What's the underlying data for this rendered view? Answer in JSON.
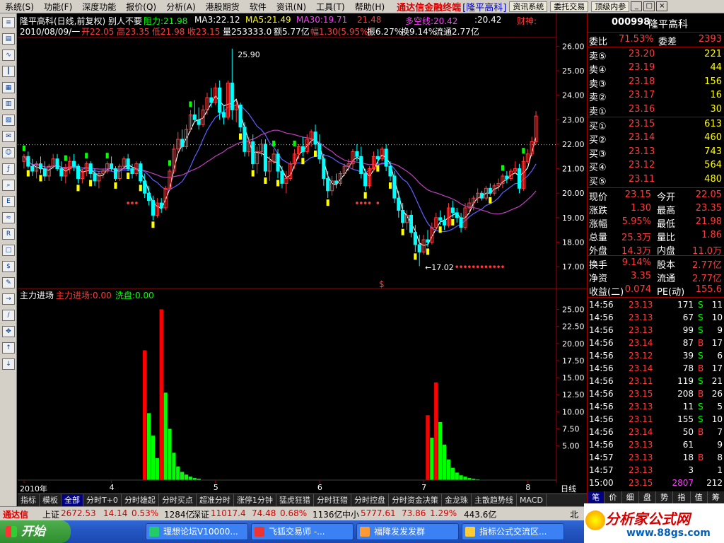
{
  "menubar": {
    "items": [
      "系统(S)",
      "功能(F)",
      "深度功能",
      "报价(Q)",
      "分析(A)",
      "港股期货",
      "软件",
      "资讯(N)",
      "工具(T)",
      "帮助(H)"
    ],
    "brand": "通达信金融终端",
    "brand_stock": "[隆平高科]",
    "buttons": [
      "资讯系统",
      "委托交易",
      "顶级内参"
    ],
    "window_controls": [
      "_",
      "□",
      "×"
    ]
  },
  "chart_header": {
    "line1_name": "隆平高科(日线,前复权) 别人不要",
    "line1_resist": "阻力:21.98",
    "line1_ma3": "MA3:22.12",
    "line1_ma5": "MA5:21.49",
    "line1_ma30": "MA30:19.71",
    "line1_ma_x": "21.48",
    "line1_duokong": "多空线:20.42",
    "line1_x2": ":20.42",
    "line1_caishen": "财神:",
    "line2_date": "2010/08/09/一",
    "line2_open": "开22.05",
    "line2_high": "高23.35",
    "line2_low": "低21.98",
    "line2_close": "收23.15",
    "line2_vol": "量253333.0",
    "line2_amount": "额5.77亿",
    "line2_range": "幅1.30(5.95%)",
    "line2_amp": "振6.27%",
    "line2_turn": "换9.14%",
    "line2_float": "流通2.77亿"
  },
  "indicator_header": {
    "name": "主力进场",
    "v1": "主力进场:0.00",
    "v2": "洗盘:0.00"
  },
  "colors": {
    "up": "#ff3c3c",
    "down": "#00ffff",
    "yellow": "#ffff00",
    "green": "#00ff00",
    "magenta": "#ff00ff",
    "ma_white": "#ffffff",
    "ma_blue": "#6060ff",
    "ma_purple": "#c040c0",
    "grid": "#a00000"
  },
  "chart_data": [
    {
      "type": "candlestick",
      "title": "隆平高科(日线,前复权)",
      "y_ticks": [
        "26.00",
        "25.00",
        "24.00",
        "23.00",
        "22.00",
        "21.00",
        "20.00",
        "19.00",
        "18.00",
        "17.00"
      ],
      "ylim": [
        16.6,
        26.3
      ],
      "x_tick_labels": [
        "2010年",
        "4",
        "5",
        "6",
        "7",
        "8"
      ],
      "x_tick_index": [
        0,
        21,
        46,
        71,
        96,
        121
      ],
      "annotations": [
        {
          "text": "25.90",
          "index": 50,
          "value": 25.9
        },
        {
          "text": "←17.02",
          "index": 96,
          "value": 17.02
        }
      ],
      "resistance_level": 21.98,
      "candles": [
        [
          21.3,
          21.6,
          21.0,
          21.5
        ],
        [
          21.5,
          21.7,
          21.0,
          21.1
        ],
        [
          21.1,
          21.4,
          20.7,
          20.9
        ],
        [
          20.9,
          21.3,
          20.6,
          21.2
        ],
        [
          21.2,
          21.5,
          20.8,
          21.0
        ],
        [
          21.0,
          21.3,
          20.5,
          20.7
        ],
        [
          20.7,
          21.2,
          20.5,
          21.1
        ],
        [
          21.1,
          21.6,
          21.0,
          21.4
        ],
        [
          21.4,
          21.6,
          20.9,
          21.0
        ],
        [
          21.0,
          21.3,
          20.5,
          20.7
        ],
        [
          20.7,
          21.2,
          20.4,
          21.0
        ],
        [
          21.0,
          21.5,
          20.8,
          21.3
        ],
        [
          21.3,
          21.6,
          20.9,
          21.1
        ],
        [
          21.1,
          21.2,
          20.4,
          20.6
        ],
        [
          20.6,
          21.0,
          20.4,
          20.9
        ],
        [
          20.9,
          21.3,
          20.7,
          21.2
        ],
        [
          21.2,
          21.3,
          20.6,
          20.8
        ],
        [
          20.8,
          21.0,
          20.3,
          20.5
        ],
        [
          20.5,
          20.9,
          20.2,
          20.8
        ],
        [
          20.8,
          21.0,
          20.6,
          20.9
        ],
        [
          20.9,
          21.3,
          20.8,
          21.2
        ],
        [
          21.2,
          21.5,
          20.9,
          21.0
        ],
        [
          21.0,
          21.1,
          20.5,
          20.6
        ],
        [
          20.6,
          21.2,
          20.5,
          21.1
        ],
        [
          21.1,
          21.5,
          21.0,
          21.4
        ],
        [
          21.4,
          21.6,
          20.9,
          21.0
        ],
        [
          21.0,
          21.2,
          20.6,
          20.8
        ],
        [
          20.8,
          21.3,
          20.7,
          21.2
        ],
        [
          21.2,
          21.3,
          20.4,
          20.5
        ],
        [
          20.5,
          20.8,
          19.8,
          20.0
        ],
        [
          20.0,
          20.3,
          19.5,
          19.7
        ],
        [
          19.7,
          19.9,
          18.9,
          19.1
        ],
        [
          19.1,
          19.8,
          19.0,
          19.6
        ],
        [
          19.6,
          19.8,
          19.2,
          19.4
        ],
        [
          19.4,
          20.3,
          19.3,
          20.2
        ],
        [
          20.2,
          21.0,
          20.1,
          20.9
        ],
        [
          20.9,
          22.0,
          20.8,
          21.8
        ],
        [
          21.8,
          22.5,
          21.6,
          22.2
        ],
        [
          22.2,
          22.6,
          21.7,
          21.9
        ],
        [
          21.9,
          22.8,
          21.8,
          22.6
        ],
        [
          22.6,
          23.4,
          22.5,
          23.2
        ],
        [
          23.2,
          23.8,
          22.9,
          23.0
        ],
        [
          23.0,
          23.5,
          22.6,
          22.8
        ],
        [
          22.8,
          23.6,
          22.7,
          23.4
        ],
        [
          23.4,
          24.1,
          23.2,
          23.9
        ],
        [
          23.9,
          24.3,
          23.5,
          23.7
        ],
        [
          23.7,
          24.5,
          23.6,
          24.3
        ],
        [
          24.3,
          24.6,
          23.0,
          23.3
        ],
        [
          23.3,
          23.6,
          22.8,
          23.1
        ],
        [
          23.1,
          24.6,
          23.0,
          24.5
        ],
        [
          24.5,
          25.9,
          23.0,
          23.4
        ],
        [
          23.4,
          23.8,
          22.9,
          23.6
        ],
        [
          23.6,
          23.7,
          22.5,
          22.7
        ],
        [
          22.7,
          22.9,
          21.5,
          21.7
        ],
        [
          21.7,
          22.3,
          21.5,
          22.1
        ],
        [
          22.1,
          22.4,
          21.0,
          21.2
        ],
        [
          21.2,
          21.9,
          20.8,
          21.7
        ],
        [
          21.7,
          22.2,
          21.5,
          22.0
        ],
        [
          22.0,
          22.2,
          20.7,
          20.9
        ],
        [
          20.9,
          21.5,
          20.5,
          21.3
        ],
        [
          21.3,
          21.8,
          21.2,
          21.6
        ],
        [
          21.6,
          21.8,
          20.6,
          20.9
        ],
        [
          20.9,
          21.1,
          20.2,
          20.4
        ],
        [
          20.4,
          20.9,
          20.0,
          20.6
        ],
        [
          20.6,
          21.3,
          20.5,
          21.2
        ],
        [
          21.2,
          21.8,
          21.0,
          21.6
        ],
        [
          21.6,
          22.0,
          21.4,
          21.9
        ],
        [
          21.9,
          22.3,
          21.5,
          21.7
        ],
        [
          21.7,
          22.4,
          21.6,
          22.2
        ],
        [
          22.2,
          22.6,
          21.9,
          22.5
        ],
        [
          22.5,
          22.8,
          21.8,
          22.0
        ],
        [
          22.0,
          22.4,
          21.2,
          21.4
        ],
        [
          21.4,
          21.6,
          20.3,
          20.6
        ],
        [
          20.6,
          20.9,
          19.8,
          20.1
        ],
        [
          20.1,
          20.7,
          19.9,
          20.5
        ],
        [
          20.5,
          20.8,
          20.2,
          20.4
        ],
        [
          20.4,
          20.9,
          20.3,
          20.8
        ],
        [
          20.8,
          21.2,
          20.7,
          21.1
        ],
        [
          21.1,
          21.4,
          20.9,
          21.2
        ],
        [
          21.2,
          21.8,
          21.0,
          21.7
        ],
        [
          21.7,
          22.0,
          21.3,
          21.5
        ],
        [
          21.5,
          21.9,
          20.6,
          20.8
        ],
        [
          20.8,
          21.0,
          20.1,
          20.3
        ],
        [
          20.3,
          21.1,
          20.2,
          21.0
        ],
        [
          21.0,
          21.7,
          20.9,
          21.5
        ],
        [
          21.5,
          21.8,
          21.2,
          21.4
        ],
        [
          21.4,
          21.9,
          21.3,
          21.8
        ],
        [
          21.8,
          22.0,
          20.9,
          21.1
        ],
        [
          21.1,
          21.3,
          20.5,
          20.7
        ],
        [
          20.7,
          20.9,
          19.6,
          19.8
        ],
        [
          19.8,
          20.1,
          19.0,
          19.3
        ],
        [
          19.3,
          19.6,
          18.6,
          18.8
        ],
        [
          18.8,
          19.3,
          18.5,
          19.1
        ],
        [
          19.1,
          19.3,
          18.2,
          18.4
        ],
        [
          18.4,
          18.7,
          17.6,
          17.9
        ],
        [
          17.9,
          18.3,
          17.02,
          17.6
        ],
        [
          17.6,
          18.3,
          17.5,
          18.1
        ],
        [
          18.1,
          18.5,
          17.8,
          18.0
        ],
        [
          18.0,
          18.8,
          17.9,
          18.6
        ],
        [
          18.6,
          19.2,
          18.5,
          19.0
        ],
        [
          19.0,
          19.3,
          18.7,
          18.9
        ],
        [
          18.9,
          19.1,
          18.5,
          18.7
        ],
        [
          18.7,
          19.6,
          18.6,
          19.4
        ],
        [
          19.4,
          19.7,
          19.0,
          19.2
        ],
        [
          19.2,
          19.4,
          18.8,
          19.0
        ],
        [
          19.0,
          19.2,
          18.4,
          18.6
        ],
        [
          18.6,
          19.6,
          18.5,
          19.4
        ],
        [
          19.4,
          19.8,
          19.2,
          19.6
        ],
        [
          19.6,
          19.9,
          19.3,
          19.8
        ],
        [
          19.8,
          20.2,
          19.6,
          20.0
        ],
        [
          20.0,
          20.1,
          19.7,
          19.8
        ],
        [
          19.8,
          20.3,
          19.7,
          20.2
        ],
        [
          20.2,
          20.4,
          19.9,
          20.0
        ],
        [
          20.0,
          20.4,
          19.9,
          20.3
        ],
        [
          20.3,
          20.6,
          20.1,
          20.4
        ],
        [
          20.4,
          20.8,
          20.2,
          20.7
        ],
        [
          20.7,
          20.9,
          20.4,
          20.6
        ],
        [
          20.6,
          21.0,
          20.5,
          20.9
        ],
        [
          20.9,
          21.3,
          20.8,
          21.0
        ],
        [
          21.0,
          21.2,
          20.0,
          20.2
        ],
        [
          20.2,
          21.5,
          20.1,
          21.3
        ],
        [
          21.3,
          21.8,
          21.2,
          21.6
        ],
        [
          21.6,
          22.3,
          21.5,
          22.1
        ],
        [
          22.1,
          23.35,
          21.98,
          23.15
        ]
      ]
    },
    {
      "type": "bar",
      "title": "主力进场",
      "y_ticks": [
        "25.00",
        "22.50",
        "20.00",
        "17.50",
        "15.00",
        "12.50",
        "10.00",
        "7.50",
        "5.00"
      ],
      "ylim": [
        0,
        26.5
      ],
      "series": [
        {
          "name": "主力进场",
          "color": "#ff0000",
          "bars": [
            [
              29,
              19.0
            ],
            [
              33,
              25.0
            ],
            [
              97,
              9.5
            ],
            [
              99,
              14.3
            ]
          ]
        },
        {
          "name": "洗盘",
          "color": "#00ff00",
          "bars": [
            [
              30,
              9.8
            ],
            [
              31,
              6.5
            ],
            [
              32,
              3.2
            ],
            [
              34,
              12.8
            ],
            [
              35,
              7.5
            ],
            [
              36,
              4.0
            ],
            [
              37,
              2.0
            ],
            [
              38,
              1.2
            ],
            [
              39,
              0.8
            ],
            [
              40,
              0.5
            ],
            [
              41,
              0.3
            ],
            [
              42,
              0.2
            ],
            [
              98,
              6.2
            ],
            [
              100,
              8.5
            ],
            [
              101,
              5.2
            ],
            [
              102,
              3.0
            ],
            [
              103,
              1.8
            ],
            [
              104,
              1.1
            ],
            [
              105,
              0.7
            ],
            [
              106,
              0.5
            ],
            [
              107,
              0.3
            ],
            [
              108,
              0.2
            ],
            [
              109,
              0.1
            ]
          ]
        }
      ]
    }
  ],
  "chart_labels": {
    "right_axis_day": "日线",
    "dollar_marker": "$"
  },
  "tabs": [
    "指标",
    "模板",
    "全部",
    "分时T+0",
    "分时雄起",
    "分时买点",
    "超准分时",
    "涨停1分钟",
    "猛虎狂猎",
    "分时狂猎",
    "分时控盘",
    "分时资金决策",
    "金龙珠",
    "主散趋势线",
    "MACD"
  ],
  "right_panel": {
    "code": "000998",
    "name": "隆平高科",
    "weibi_label": "委比",
    "weibi_value": "71.53%",
    "weicha_label": "委差",
    "weicha_value": "2393",
    "asks": [
      {
        "label": "卖⑤",
        "price": "23.20",
        "vol": "221"
      },
      {
        "label": "卖④",
        "price": "23.19",
        "vol": "44"
      },
      {
        "label": "卖③",
        "price": "23.18",
        "vol": "156"
      },
      {
        "label": "卖②",
        "price": "23.17",
        "vol": "16"
      },
      {
        "label": "卖①",
        "price": "23.16",
        "vol": "30"
      }
    ],
    "bids": [
      {
        "label": "买①",
        "price": "23.15",
        "vol": "613"
      },
      {
        "label": "买②",
        "price": "23.14",
        "vol": "460"
      },
      {
        "label": "买③",
        "price": "23.13",
        "vol": "743"
      },
      {
        "label": "买④",
        "price": "23.12",
        "vol": "564"
      },
      {
        "label": "买⑤",
        "price": "23.11",
        "vol": "480"
      }
    ],
    "stats": [
      {
        "l1": "现价",
        "v1": "23.15",
        "l2": "今开",
        "v2": "22.05"
      },
      {
        "l1": "涨跌",
        "v1": "1.30",
        "l2": "最高",
        "v2": "23.35"
      },
      {
        "l1": "涨幅",
        "v1": "5.95%",
        "l2": "最低",
        "v2": "21.98"
      },
      {
        "l1": "总量",
        "v1": "25.3万",
        "l2": "量比",
        "v2": "1.86"
      },
      {
        "l1": "外盘",
        "v1": "14.3万",
        "l2": "内盘",
        "v2": "11.0万"
      }
    ],
    "stats2": [
      {
        "l1": "换手",
        "v1": "9.14%",
        "l2": "股本",
        "v2": "2.77亿"
      },
      {
        "l1": "净资",
        "v1": "3.35",
        "l2": "流通",
        "v2": "2.77亿"
      },
      {
        "l1": "收益(二)",
        "v1": "0.074",
        "l2": "PE(动)",
        "v2": "155.6"
      }
    ],
    "ticks": [
      {
        "time": "14:56",
        "price": "23.13",
        "vol": "171",
        "bs": "S",
        "n": "11"
      },
      {
        "time": "14:56",
        "price": "23.13",
        "vol": "67",
        "bs": "S",
        "n": "10"
      },
      {
        "time": "14:56",
        "price": "23.13",
        "vol": "99",
        "bs": "S",
        "n": "9"
      },
      {
        "time": "14:56",
        "price": "23.14",
        "vol": "87",
        "bs": "B",
        "n": "17"
      },
      {
        "time": "14:56",
        "price": "23.12",
        "vol": "39",
        "bs": "S",
        "n": "6"
      },
      {
        "time": "14:56",
        "price": "23.14",
        "vol": "78",
        "bs": "B",
        "n": "17"
      },
      {
        "time": "14:56",
        "price": "23.11",
        "vol": "119",
        "bs": "S",
        "n": "21"
      },
      {
        "time": "14:56",
        "price": "23.15",
        "vol": "208",
        "bs": "B",
        "n": "26"
      },
      {
        "time": "14:56",
        "price": "23.13",
        "vol": "11",
        "bs": "S",
        "n": "5"
      },
      {
        "time": "14:56",
        "price": "23.11",
        "vol": "155",
        "bs": "S",
        "n": "10"
      },
      {
        "time": "14:56",
        "price": "23.14",
        "vol": "50",
        "bs": "B",
        "n": "7"
      },
      {
        "time": "14:56",
        "price": "23.13",
        "vol": "61",
        "bs": "",
        "n": "9"
      },
      {
        "time": "14:57",
        "price": "23.13",
        "vol": "18",
        "bs": "B",
        "n": "8"
      },
      {
        "time": "14:57",
        "price": "23.13",
        "vol": "3",
        "bs": "",
        "n": "1"
      },
      {
        "time": "15:00",
        "price": "23.15",
        "vol": "2807",
        "bs": "",
        "n": "212"
      }
    ],
    "bottom_tabs": [
      "笔",
      "价",
      "细",
      "盘",
      "势",
      "指",
      "值",
      "筹"
    ]
  },
  "statusbar": {
    "brand": "通达信",
    "sh_label": "上证",
    "sh_val": "2672.53",
    "sh_chg": "14.14",
    "sh_pct": "0.53%",
    "sh_amt": "1284亿",
    "sz_label": "深证",
    "sz_val": "11017.4",
    "sz_chg": "74.48",
    "sz_pct": "0.68%",
    "sz_amt": "1136亿",
    "zx_label": "中小",
    "zx_val": "5777.61",
    "zx_chg": "73.86",
    "zx_pct": "1.29%",
    "zx_amt": "443.6亿",
    "north": "北"
  },
  "taskbar": {
    "start": "开始",
    "tasks": [
      "理想论坛V10000...",
      "飞狐交易师 -...",
      "福降发发发群",
      "指标公式交流区..."
    ]
  },
  "watermark": {
    "cn": "分析家公式网",
    "url": "www.88gs.com"
  }
}
